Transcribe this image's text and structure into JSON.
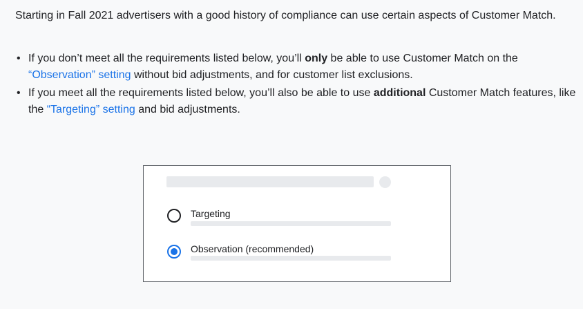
{
  "intro": {
    "text": "Starting in Fall 2021 advertisers with a good history of compliance can use certain aspects of Customer Match."
  },
  "bullets": [
    {
      "pre": "If you don’t meet all the requirements listed below, you’ll ",
      "bold": "only",
      "mid": " be able to use Customer Match on the ",
      "link": "“Observation” setting",
      "post": " without bid adjustments, and for customer list exclusions."
    },
    {
      "pre": "If you meet all the requirements listed below, you’ll also be able to use ",
      "bold": "additional",
      "mid": " Customer Match features, like the ",
      "link": "“Targeting” setting",
      "post": " and bid adjustments."
    }
  ],
  "illustration": {
    "options": [
      {
        "label": "Targeting",
        "selected": false
      },
      {
        "label": "Observation (recommended)",
        "selected": true
      }
    ]
  }
}
